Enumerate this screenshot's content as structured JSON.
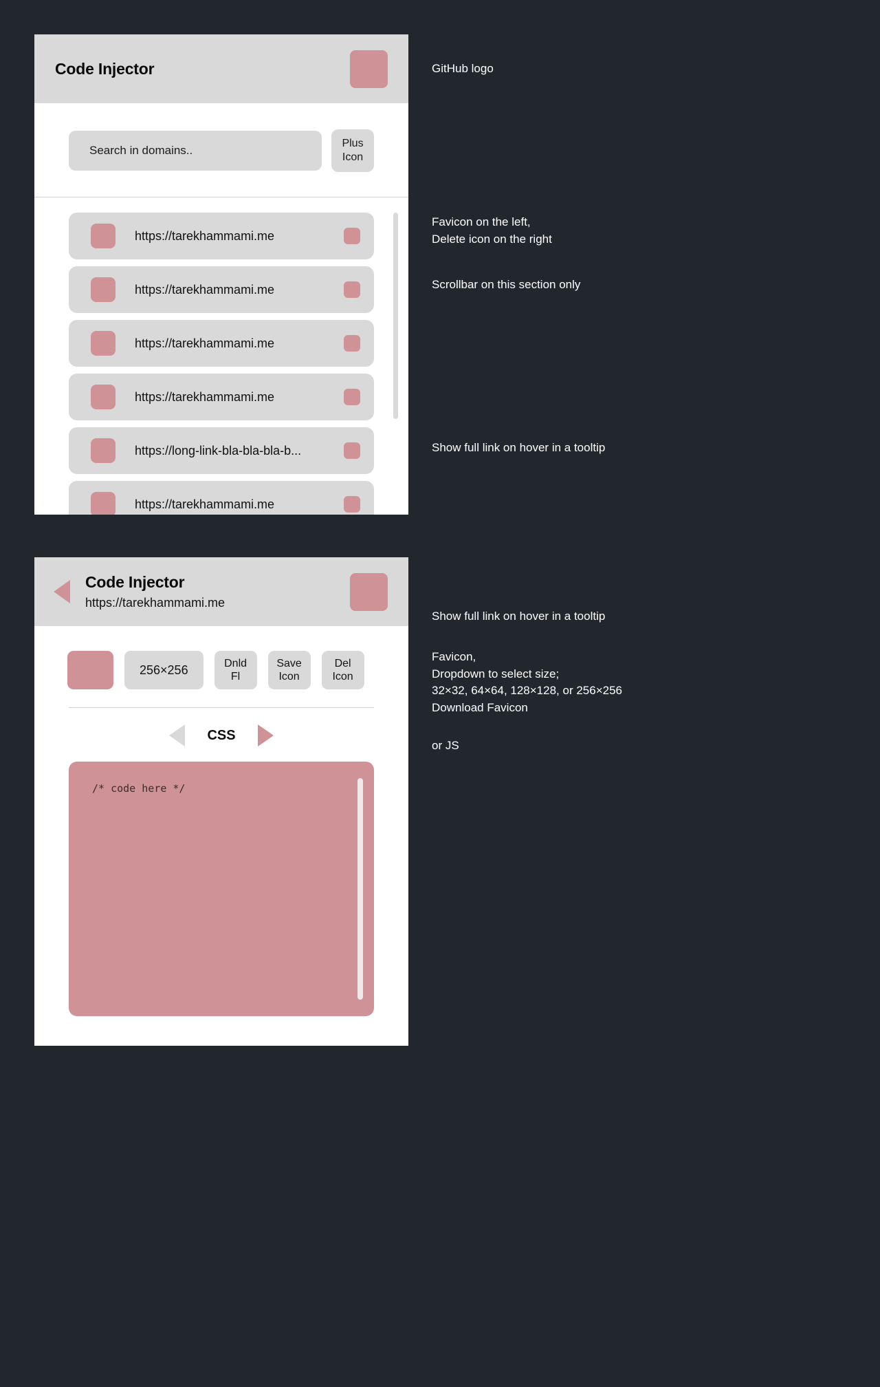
{
  "popup": {
    "title": "Code Injector",
    "logo_placeholder": "github-logo-placeholder",
    "search": {
      "placeholder": "Search in domains..",
      "value": ""
    },
    "add_button": {
      "line1": "Plus",
      "line2": "Icon"
    },
    "domains": [
      {
        "url": "https://tarekhammami.me"
      },
      {
        "url": "https://tarekhammami.me"
      },
      {
        "url": "https://tarekhammami.me"
      },
      {
        "url": "https://tarekhammami.me"
      },
      {
        "url": "https://long-link-bla-bla-bla-b..."
      },
      {
        "url": "https://tarekhammami.me"
      }
    ]
  },
  "detail": {
    "title": "Code Injector",
    "subtitle": "https://tarekhammami.me",
    "logo_placeholder": "github-logo-placeholder",
    "toolbar": {
      "favicon_placeholder": "favicon-placeholder",
      "size_value": "256×256",
      "download_button": {
        "line1": "Dnld",
        "line2": "Fl"
      },
      "save_button": {
        "line1": "Save",
        "line2": "Icon"
      },
      "delete_button": {
        "line1": "Del",
        "line2": "Icon"
      }
    },
    "language": {
      "current": "CSS",
      "prev_arrow": "triangle-left-icon",
      "next_arrow": "triangle-right-icon"
    },
    "editor": {
      "content": "/* code here */"
    },
    "back_arrow": "triangle-left-icon"
  },
  "annotations": [
    {
      "id": "github-logo",
      "text": "GitHub logo"
    },
    {
      "id": "favicon-delete",
      "text": "Favicon on the left,\nDelete icon on the right"
    },
    {
      "id": "scrollbar",
      "text": "Scrollbar on this section only"
    },
    {
      "id": "tooltip-list",
      "text": "Show full link on hover in a tooltip"
    },
    {
      "id": "tooltip-detail",
      "text": "Show full link on hover in a tooltip"
    },
    {
      "id": "favicon-sizes",
      "text": "Favicon,\nDropdown to select size;\n32×32, 64×64, 128×128, or 256×256\nDownload Favicon"
    },
    {
      "id": "or-js",
      "text": "or JS"
    }
  ],
  "colors": {
    "background": "#22272e",
    "card": "#ffffff",
    "chrome": "#d9d9d9",
    "accent": "#cf9397",
    "text": "#111111",
    "anno_text": "#ffffff"
  }
}
